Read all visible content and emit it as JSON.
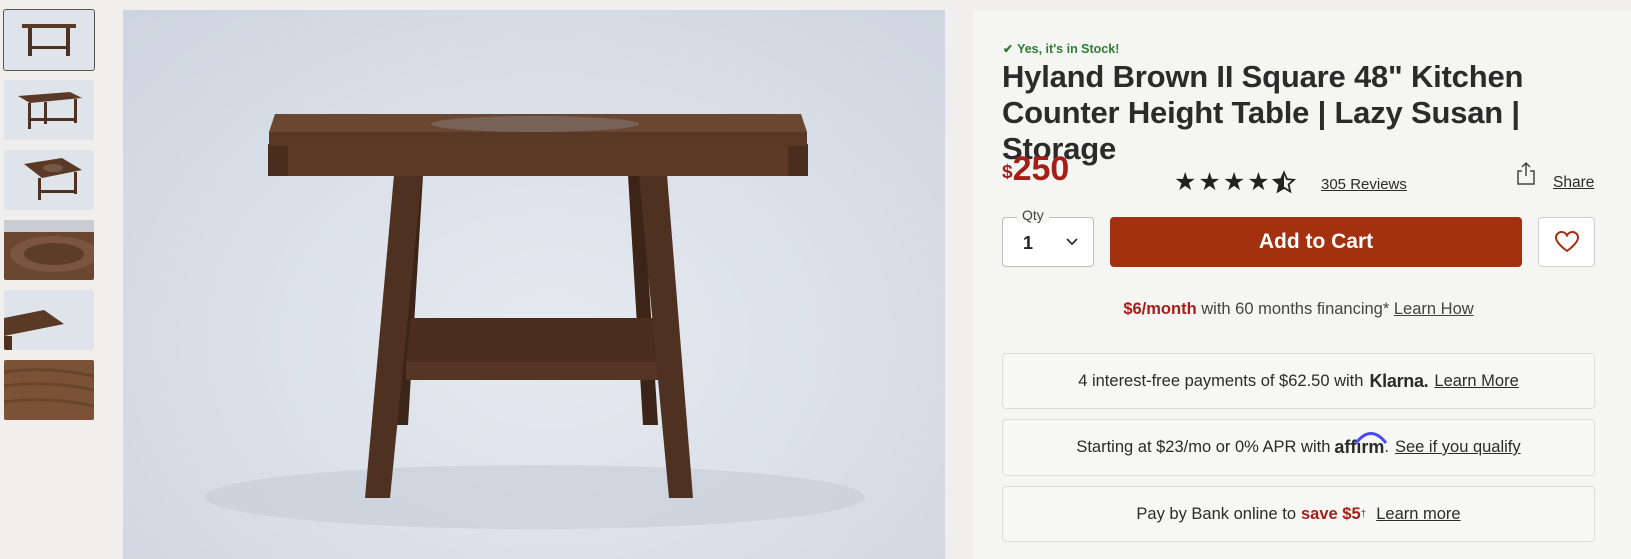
{
  "thumbnails": [
    {
      "name": "thumb-front-view",
      "active": true
    },
    {
      "name": "thumb-angle-view",
      "active": false
    },
    {
      "name": "thumb-top-angle-view",
      "active": false
    },
    {
      "name": "thumb-lazy-susan-detail",
      "active": false
    },
    {
      "name": "thumb-corner-detail",
      "active": false
    },
    {
      "name": "thumb-wood-grain-detail",
      "active": false
    }
  ],
  "product": {
    "stock_text": "Yes, it's in Stock!",
    "title": "Hyland Brown II Square 48\" Kitchen Counter Height Table | Lazy Susan | Storage",
    "price_currency": "$",
    "price_amount": "250",
    "rating": 4.5,
    "reviews_label": "305 Reviews",
    "share_label": "Share"
  },
  "purchase": {
    "qty_label": "Qty",
    "qty_value": "1",
    "add_to_cart_label": "Add to Cart"
  },
  "financing": {
    "monthly": "$6/month",
    "text": " with 60 months financing* ",
    "link": "Learn How"
  },
  "klarna": {
    "text": "4 interest-free payments of $62.50 with",
    "logo": "Klarna.",
    "link": "Learn More"
  },
  "affirm": {
    "text": "Starting at $23/mo or 0% APR with",
    "logo": "affirm",
    "suffix": ".",
    "link": "See if you qualify"
  },
  "bank": {
    "text": "Pay by Bank online to",
    "save": "save $5",
    "dagger": "†",
    "link": "Learn more"
  },
  "colors": {
    "price_red": "#a51f17",
    "cart_button": "#a3300f",
    "stock_green": "#2f7d32",
    "wood": "#4e3121"
  }
}
